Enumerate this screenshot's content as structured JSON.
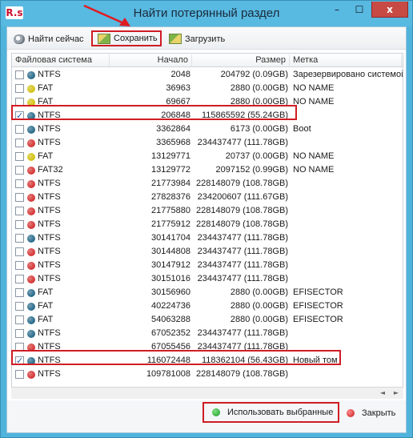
{
  "window": {
    "app_icon": "R.s",
    "title": "Найти потерянный раздел",
    "minimize": "–",
    "maximize": "☐",
    "close": "x"
  },
  "toolbar": {
    "find_label": "Найти сейчас",
    "save_label": "Сохранить",
    "load_label": "Загрузить"
  },
  "table": {
    "columns": [
      "Файловая система",
      "Начало",
      "Размер",
      "Метка"
    ],
    "rows": [
      {
        "checked": false,
        "color": "#2e6f8e",
        "fs": "NTFS",
        "start": "2048",
        "size": "204792 (0.09GB)",
        "label": "Зарезервировано системой"
      },
      {
        "checked": false,
        "color": "#d4c41a",
        "fs": "FAT",
        "start": "36963",
        "size": "2880 (0.00GB)",
        "label": "NO NAME"
      },
      {
        "checked": false,
        "color": "#d4c41a",
        "fs": "FAT",
        "start": "69667",
        "size": "2880 (0.00GB)",
        "label": "NO NAME"
      },
      {
        "checked": true,
        "color": "#2e6f8e",
        "fs": "NTFS",
        "start": "206848",
        "size": "115865592 (55.24GB)",
        "label": ""
      },
      {
        "checked": false,
        "color": "#2e6f8e",
        "fs": "NTFS",
        "start": "3362864",
        "size": "6173 (0.00GB)",
        "label": "Boot"
      },
      {
        "checked": false,
        "color": "#d63a3a",
        "fs": "NTFS",
        "start": "3365968",
        "size": "234437477 (111.78GB)",
        "label": ""
      },
      {
        "checked": false,
        "color": "#d4c41a",
        "fs": "FAT",
        "start": "13129771",
        "size": "20737 (0.00GB)",
        "label": "NO NAME"
      },
      {
        "checked": false,
        "color": "#d63a3a",
        "fs": "FAT32",
        "start": "13129772",
        "size": "2097152 (0.99GB)",
        "label": "NO NAME"
      },
      {
        "checked": false,
        "color": "#d63a3a",
        "fs": "NTFS",
        "start": "21773984",
        "size": "228148079 (108.78GB)",
        "label": ""
      },
      {
        "checked": false,
        "color": "#d63a3a",
        "fs": "NTFS",
        "start": "27828376",
        "size": "234200607 (111.67GB)",
        "label": ""
      },
      {
        "checked": false,
        "color": "#d63a3a",
        "fs": "NTFS",
        "start": "21775880",
        "size": "228148079 (108.78GB)",
        "label": ""
      },
      {
        "checked": false,
        "color": "#d63a3a",
        "fs": "NTFS",
        "start": "21775912",
        "size": "228148079 (108.78GB)",
        "label": ""
      },
      {
        "checked": false,
        "color": "#2e6f8e",
        "fs": "NTFS",
        "start": "30141704",
        "size": "234437477 (111.78GB)",
        "label": ""
      },
      {
        "checked": false,
        "color": "#d63a3a",
        "fs": "NTFS",
        "start": "30144808",
        "size": "234437477 (111.78GB)",
        "label": ""
      },
      {
        "checked": false,
        "color": "#d63a3a",
        "fs": "NTFS",
        "start": "30147912",
        "size": "234437477 (111.78GB)",
        "label": ""
      },
      {
        "checked": false,
        "color": "#d63a3a",
        "fs": "NTFS",
        "start": "30151016",
        "size": "234437477 (111.78GB)",
        "label": ""
      },
      {
        "checked": false,
        "color": "#2e6f8e",
        "fs": "FAT",
        "start": "30156960",
        "size": "2880 (0.00GB)",
        "label": "EFISECTOR"
      },
      {
        "checked": false,
        "color": "#2e6f8e",
        "fs": "FAT",
        "start": "40224736",
        "size": "2880 (0.00GB)",
        "label": "EFISECTOR"
      },
      {
        "checked": false,
        "color": "#2e6f8e",
        "fs": "FAT",
        "start": "54063288",
        "size": "2880 (0.00GB)",
        "label": "EFISECTOR"
      },
      {
        "checked": false,
        "color": "#2e6f8e",
        "fs": "NTFS",
        "start": "67052352",
        "size": "234437477 (111.78GB)",
        "label": ""
      },
      {
        "checked": false,
        "color": "#d63a3a",
        "fs": "NTFS",
        "start": "67055456",
        "size": "234437477 (111.78GB)",
        "label": ""
      },
      {
        "checked": true,
        "color": "#2e6f8e",
        "fs": "NTFS",
        "start": "116072448",
        "size": "118362104 (56.43GB)",
        "label": "Новый том"
      },
      {
        "checked": false,
        "color": "#d63a3a",
        "fs": "NTFS",
        "start": "109781008",
        "size": "228148079 (108.78GB)",
        "label": ""
      }
    ]
  },
  "scrollbar": {
    "left": "◄",
    "right": "►"
  },
  "footer": {
    "use_selected": "Использовать выбранные",
    "close": "Закрыть"
  },
  "colors": {
    "accent_border": "#d01c24",
    "window_frame": "#4fb3dc"
  }
}
